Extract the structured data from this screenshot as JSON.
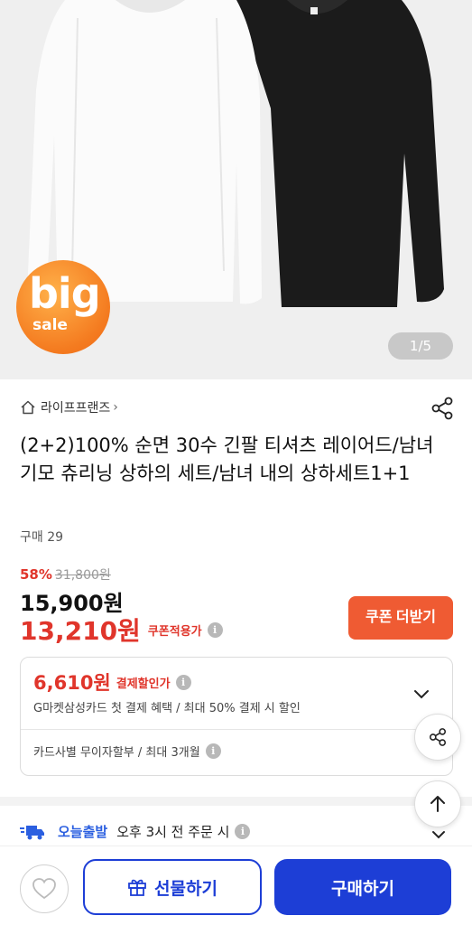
{
  "hero": {
    "badge_big": "big",
    "badge_sale": "sale",
    "pager": "1/5"
  },
  "product": {
    "seller": "라이프프랜즈",
    "seller_chevron": "›",
    "title": "(2+2)100% 순면 30수 긴팔 티셔츠 레이어드/남녀 기모 츄리닝 상하의 세트/남녀 내의 상하세트1+1",
    "purchase_count": "구매 29",
    "discount_rate": "58%",
    "original_price": "31,800원",
    "price": "15,900원",
    "coupon_price": "13,210원",
    "coupon_price_label": "쿠폰적용가",
    "coupon_button": "쿠폰 더받기"
  },
  "payment": {
    "amount": "6,610원",
    "amount_label": "결제할인가",
    "description": "G마켓삼성카드 첫 결제 혜택 / 최대 50% 결제 시 할인",
    "installment": "카드사별 무이자할부 / 최대 3개월"
  },
  "delivery": {
    "brand": "오늘출발",
    "text": "오후 3시 전 주문 시"
  },
  "bottom_bar": {
    "gift_button": "선물하기",
    "buy_button": "구매하기"
  },
  "icons": {
    "info": "i"
  },
  "colors": {
    "accent_red": "#e0352b",
    "coupon_orange": "#ef5b33",
    "brand_blue": "#1d3ed6",
    "badge_orange": "#f47a1f"
  }
}
